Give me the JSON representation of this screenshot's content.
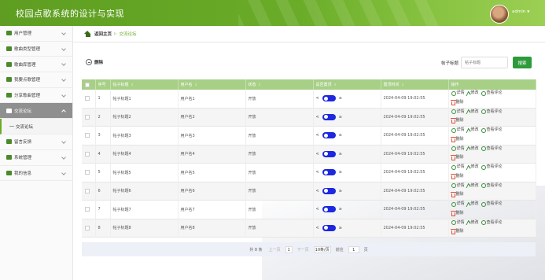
{
  "app": {
    "title": "校园点歌系统的设计与实现",
    "user": "admin"
  },
  "sidebar": {
    "items": [
      {
        "label": "用户管理",
        "icon": "list-icon",
        "color": "#4a8a2a"
      },
      {
        "label": "歌曲类型管理",
        "icon": "image-icon",
        "color": "#4a8a2a"
      },
      {
        "label": "歌曲库管理",
        "icon": "user-icon",
        "color": "#4a8a2a"
      },
      {
        "label": "我要点歌管理",
        "icon": "doc-icon",
        "color": "#4a8a2a"
      },
      {
        "label": "分享歌曲管理",
        "icon": "grid-icon",
        "color": "#4a8a2a"
      },
      {
        "label": "交流论坛",
        "icon": "forum-icon",
        "color": "#2f6b1e",
        "active": true
      },
      {
        "label": "留言反馈",
        "icon": "grid-icon",
        "color": "#4a8a2a"
      },
      {
        "label": "系统管理",
        "icon": "gear-icon",
        "color": "#4a8a2a"
      },
      {
        "label": "我的信息",
        "icon": "card-icon",
        "color": "#4a8a2a"
      }
    ],
    "sub": "交流论坛"
  },
  "breadcrumb": {
    "home": "返回主页",
    "current": "交流论坛"
  },
  "toolbar": {
    "delete": "删除",
    "search_label": "帖子标题",
    "search_placeholder": "帖子标题",
    "search_button": "搜索"
  },
  "table": {
    "headers": [
      "序号",
      "帖子标题",
      "用户名",
      "状态",
      "是否置顶",
      "置顶时间",
      "操作"
    ],
    "toggle_left": "<",
    "toggle_right": "≥",
    "ops": {
      "detail": "详情",
      "edit": "修改",
      "comments": "查看评论",
      "delete": "删除"
    },
    "rows": [
      {
        "no": "1",
        "title": "帖子标题1",
        "user": "用户名1",
        "status": "开放",
        "time": "2024-04-09 19:02:55"
      },
      {
        "no": "2",
        "title": "帖子标题2",
        "user": "用户名2",
        "status": "开放",
        "time": "2024-04-09 19:02:55"
      },
      {
        "no": "3",
        "title": "帖子标题3",
        "user": "用户名3",
        "status": "开放",
        "time": "2024-04-09 19:02:55"
      },
      {
        "no": "4",
        "title": "帖子标题4",
        "user": "用户名4",
        "status": "开放",
        "time": "2024-04-09 19:02:55"
      },
      {
        "no": "5",
        "title": "帖子标题5",
        "user": "用户名5",
        "status": "开放",
        "time": "2024-04-09 19:02:55"
      },
      {
        "no": "6",
        "title": "帖子标题6",
        "user": "用户名6",
        "status": "开放",
        "time": "2024-04-09 19:02:55"
      },
      {
        "no": "7",
        "title": "帖子标题7",
        "user": "用户名7",
        "status": "开放",
        "time": "2024-04-09 19:02:55"
      },
      {
        "no": "8",
        "title": "帖子标题8",
        "user": "用户名8",
        "status": "开放",
        "time": "2024-04-09 19:02:55"
      }
    ]
  },
  "pager": {
    "total": "共 8 条",
    "prev": "上一页",
    "page": "1",
    "next": "下一页",
    "size": "10条/页",
    "goto": "前往",
    "goto_page": "1",
    "unit": "页"
  },
  "colors": {
    "header": "#6aac28",
    "accent": "#6aac28",
    "search_button": "#2e9b3a",
    "toggle": "#1d28e0",
    "table_head": "#a7cf86"
  }
}
